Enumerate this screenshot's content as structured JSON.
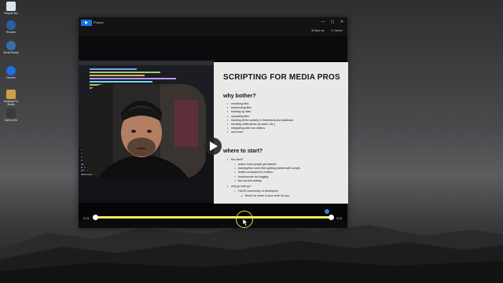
{
  "desktop": {
    "icons": [
      {
        "label": "Recycle Bin",
        "color": "#d9e6f2"
      },
      {
        "label": "Resolve",
        "color": "#2b5fa6"
      },
      {
        "label": "Media Ready",
        "color": "#3a6ea8"
      },
      {
        "label": "Chrome",
        "color": "#1f6fe0"
      },
      {
        "label": "Scripting For Media",
        "color": "#c9a34a"
      },
      {
        "label": "DaVinci Re",
        "color": "#3a3a3a"
      }
    ]
  },
  "window": {
    "app_badge": "▶",
    "title": "Photos",
    "save_label": "Save as",
    "cancel_label": "Cancel",
    "controls": [
      "—",
      "▢",
      "✕"
    ]
  },
  "editor": {
    "terminal_lines": [
      "davesharts@ferrari:~$ cd workbook",
      "davesharts@ferrari:~$ python3 run.py",
      "ok",
      "ok scripts starting up",
      "davesharts@ferrari: DB/scripts/media/from_script_media_run_rename.jes",
      "# details",
      "All done",
      "davesharts@ferrari:~$ "
    ]
  },
  "slide": {
    "title": "SCRIPTING FOR MEDIA PROS",
    "section1": "why bother?",
    "bullets1": [
      "renaming files",
      "transcoding files",
      "backing up data",
      "uploading files",
      "tracking all the activity in timecharts and database",
      "sending notifications (to slack, etc.)",
      "integrating with non-editors",
      "and more"
    ],
    "section2": "where to start?",
    "bullets2": [
      "the shell?"
    ],
    "sub2": [
      "where most people get started",
      "bash/python work then getting started with scripts",
      "limited compared to modern",
      "troublesome but logging",
      "few current activity"
    ],
    "bullets3": [
      "why go with py?"
    ],
    "sub3": [
      "HUGE community of developers"
    ],
    "subsub3": [
      "they'll do some in your work for you"
    ]
  },
  "player": {
    "time_start": "0:21",
    "time_end": "3:21",
    "trim_start_fraction": 0.0,
    "trim_end_fraction": 1.0,
    "playhead_fraction": 0.63,
    "accent": "#f2ee5c",
    "marker_color": "#2f7fe8"
  }
}
